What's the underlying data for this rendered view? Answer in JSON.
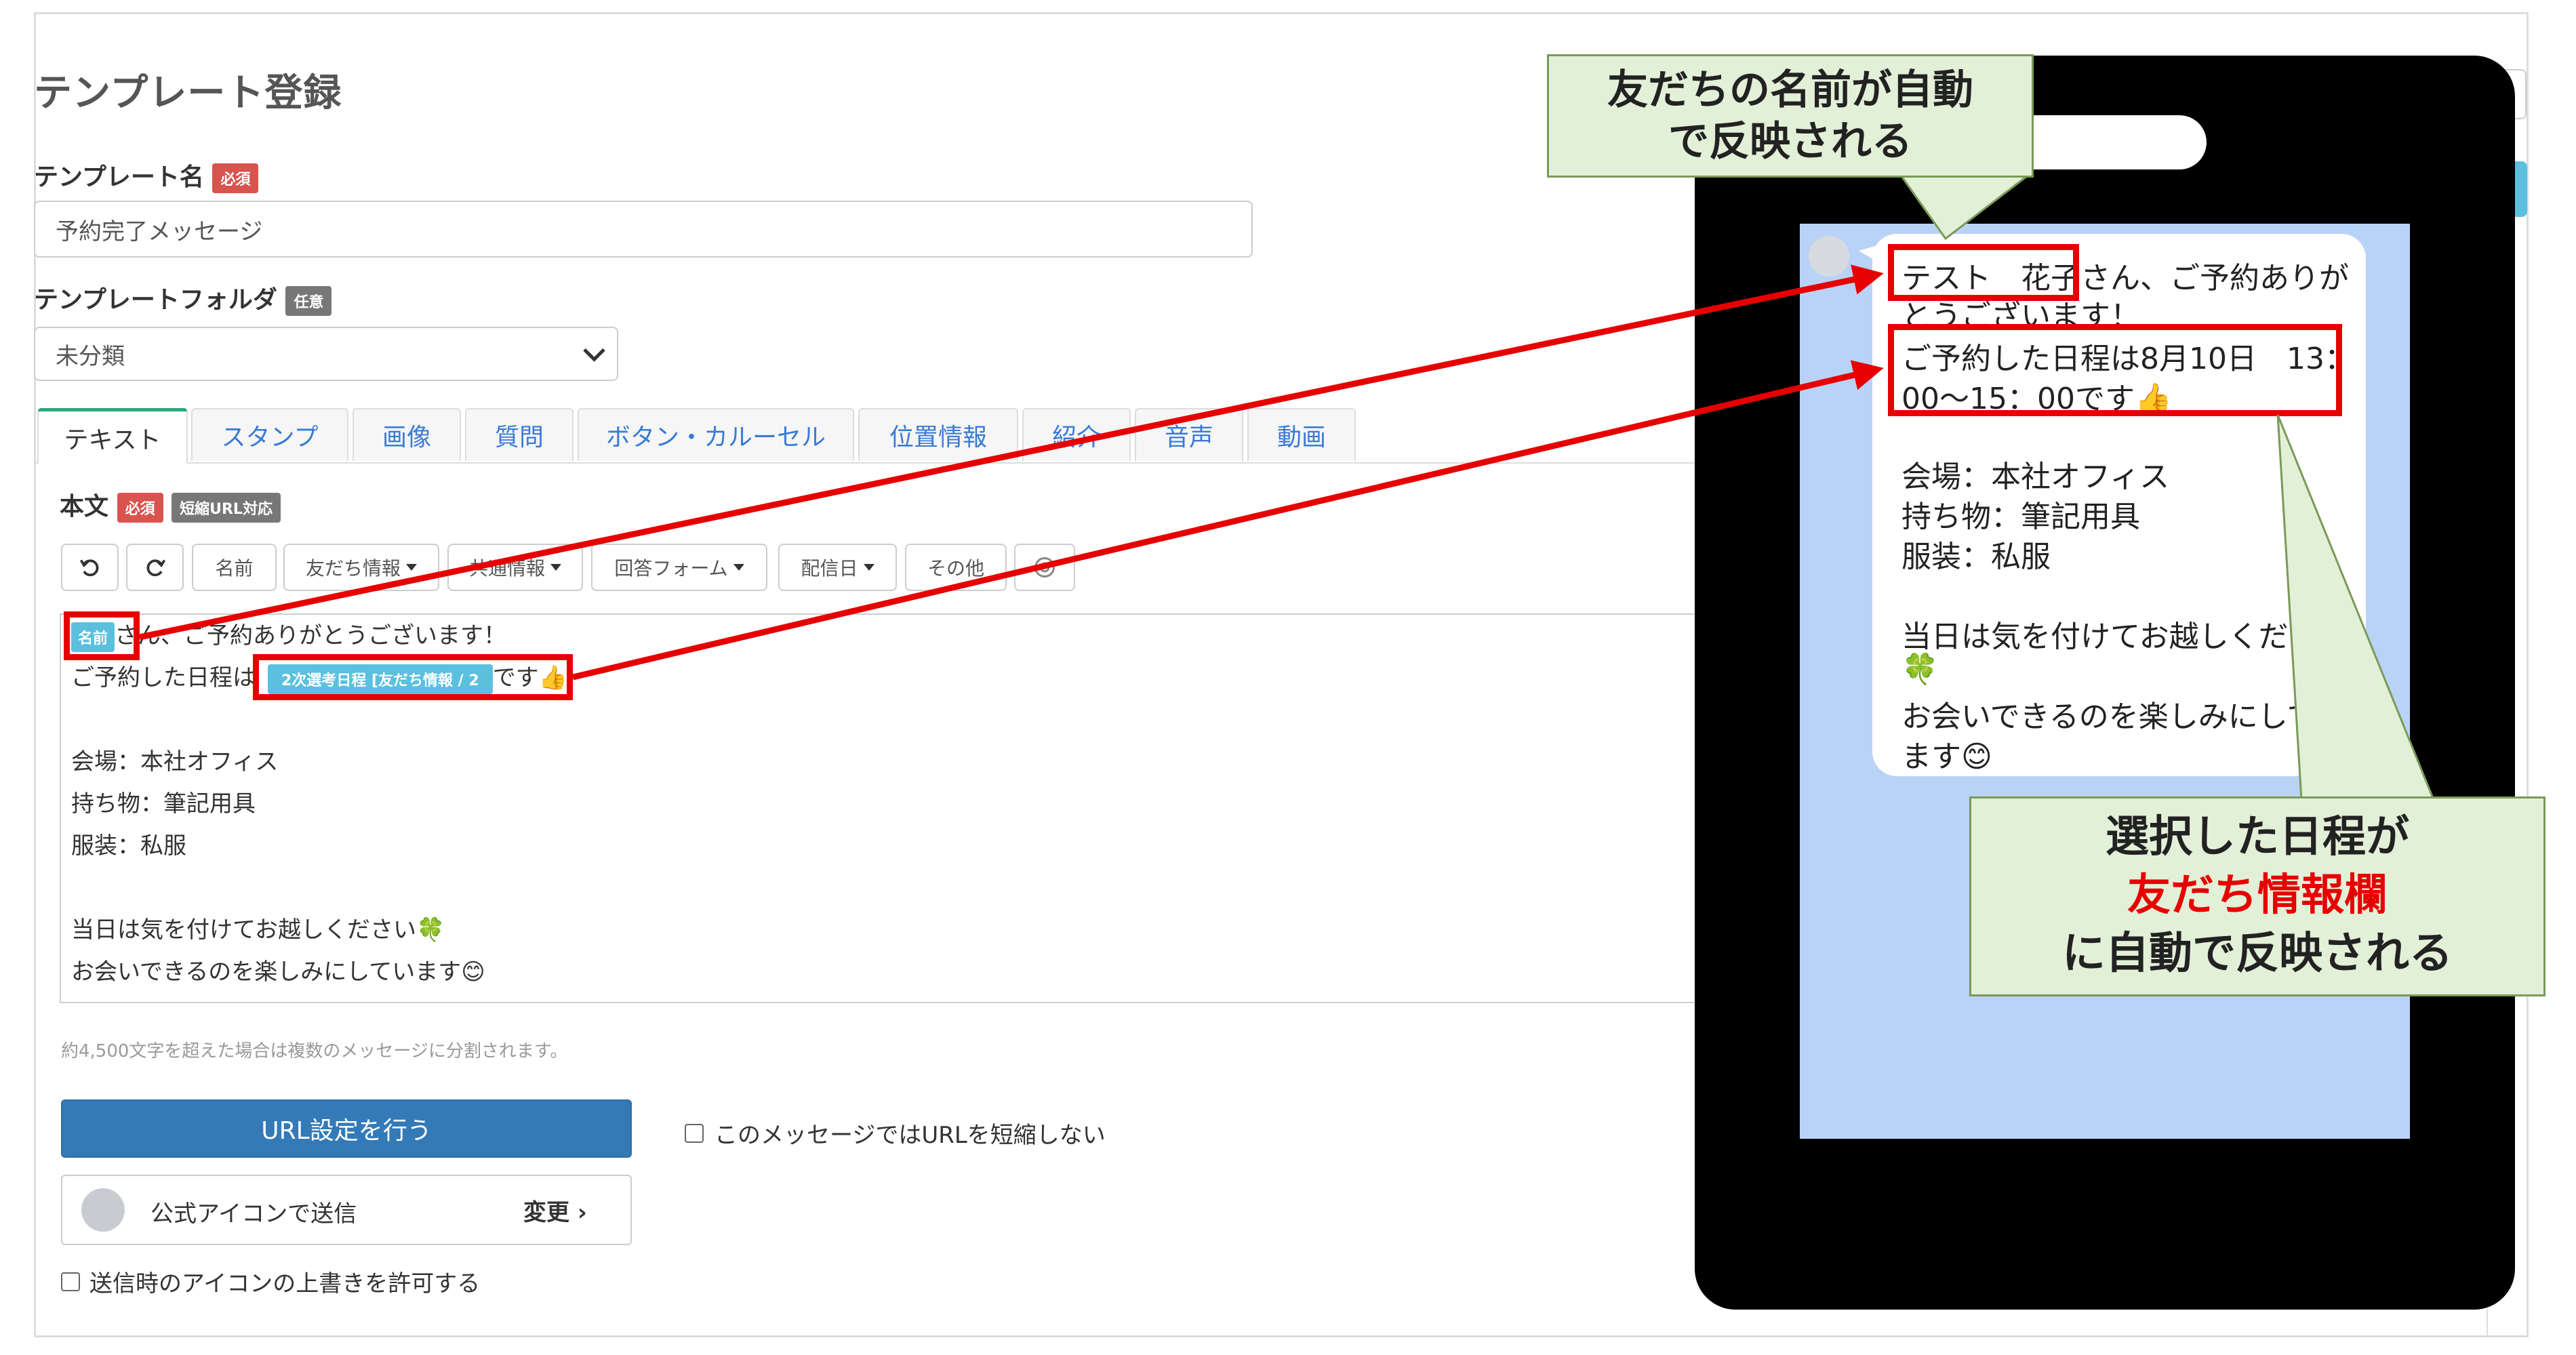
{
  "page": {
    "title": "テンプレート登録",
    "template_name": {
      "label": "テンプレート名",
      "badge": "必須",
      "value": "予約完了メッセージ"
    },
    "template_folder": {
      "label": "テンプレートフォルダ",
      "badge": "任意",
      "value": "未分類"
    },
    "tabs": [
      "テキスト",
      "スタンプ",
      "画像",
      "質問",
      "ボタン・カルーセル",
      "位置情報",
      "紹介",
      "音声",
      "動画"
    ],
    "body": {
      "label": "本文",
      "badge_required": "必須",
      "badge_url": "短縮URL対応"
    },
    "toolbar": {
      "name": "名前",
      "friend_info": "友だち情報",
      "common_info": "共通情報",
      "answer_form": "回答フォーム",
      "delivery_date": "配信日",
      "other": "その他"
    },
    "editor": {
      "name_tag": "名前",
      "line1_rest": "さん、ご予約ありがとうございます！",
      "line2_pre": "ご予約した日程は",
      "date_tag": "2次選考日程 [友だち情報 / 2",
      "line2_post": "です👍",
      "line4": "会場：本社オフィス",
      "line5": "持ち物：筆記用具",
      "line6": "服装：私服",
      "line8": "当日は気を付けてお越しください🍀",
      "line9": "お会いできるのを楽しみにしています😊"
    },
    "char_note": "約4,500文字を超えた場合は複数のメッセージに分割されます。",
    "url_button": "URL設定を行う",
    "no_shorten_label": "このメッセージではURLを短縮しない",
    "sender": {
      "label": "公式アイコンで送信",
      "change": "変更"
    },
    "allow_icon_override": "送信時のアイコンの上書きを許可する"
  },
  "preview": {
    "lines": [
      "テスト　花子さん、ご予約ありが",
      "とうございます！",
      "ご予約した日程は8月10日　13：",
      "00～15：00です👍",
      "",
      "会場：本社オフィス",
      "持ち物：筆記用具",
      "服装：私服",
      "",
      "当日は気を付けてお越しくださ",
      "🍀",
      "お会いできるのを楽しみにして",
      "ます😊"
    ]
  },
  "callouts": {
    "top": {
      "line1": "友だちの名前が自動",
      "line2": "で反映される"
    },
    "bottom": {
      "line1": "選択した日程が",
      "line2": "友だち情報欄",
      "line3": "に自動で反映される",
      "highlight_color": "#e60000"
    }
  },
  "colors": {
    "annotation_red": "#e60000",
    "callout_bg": "#e3f0d8",
    "primary_blue": "#337ab7",
    "preview_bg": "#b9d3f6",
    "tab_active": "#2aa87a"
  }
}
